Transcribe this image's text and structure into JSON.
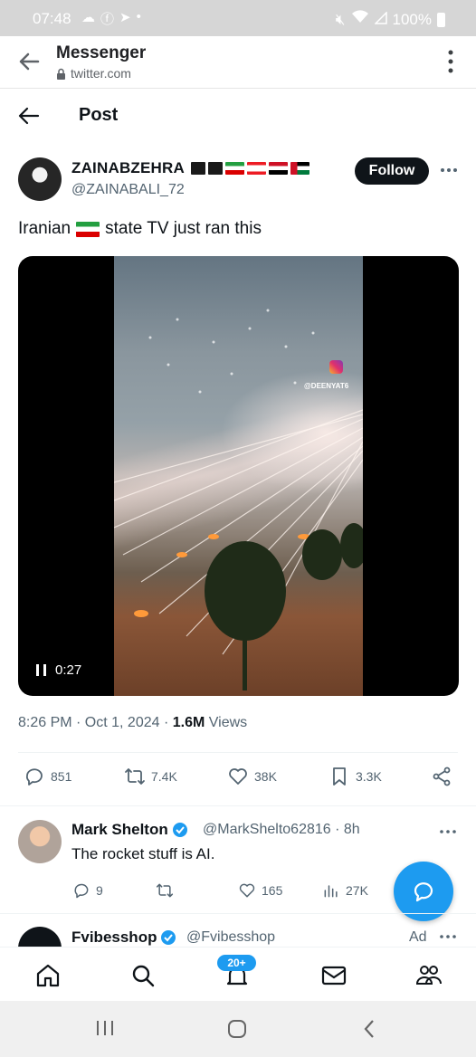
{
  "status_bar": {
    "time": "07:48",
    "battery": "100%",
    "left_icons": [
      "cloud-icon",
      "facebook-icon",
      "telegram-icon",
      "dot-icon"
    ],
    "right_icons": [
      "mute-icon",
      "wifi-icon",
      "signal-icon",
      "battery-icon"
    ]
  },
  "browser": {
    "title": "Messenger",
    "url": "twitter.com"
  },
  "post_header": {
    "title": "Post"
  },
  "tweet": {
    "author_name": "ZAINABZEHRA",
    "author_handle": "@ZAINABALI_72",
    "follow_label": "Follow",
    "text_before_flag": "Iranian",
    "text_after_flag": "state TV just ran this",
    "video": {
      "watermark": "@DEENYAT6",
      "duration": "0:27"
    },
    "timestamp": "8:26 PM · Oct 1, 2024 · ",
    "views_count": "1.6M",
    "views_label": " Views",
    "stats": {
      "replies": "851",
      "reposts": "7.4K",
      "likes": "38K",
      "bookmarks": "3.3K"
    }
  },
  "reply": {
    "name": "Mark Shelton",
    "handle": "@MarkShelto62816 · 8h",
    "text": "The rocket stuff is AI.",
    "stats": {
      "replies": "9",
      "likes": "165",
      "views": "27K"
    }
  },
  "ad": {
    "name": "Fvibesshop",
    "handle": "@Fvibesshop",
    "label": "Ad"
  },
  "bottom_nav": {
    "notifications_badge": "20+"
  },
  "colors": {
    "accent": "#1d9bf0",
    "text": "#0f1419",
    "secondary": "#536471"
  }
}
